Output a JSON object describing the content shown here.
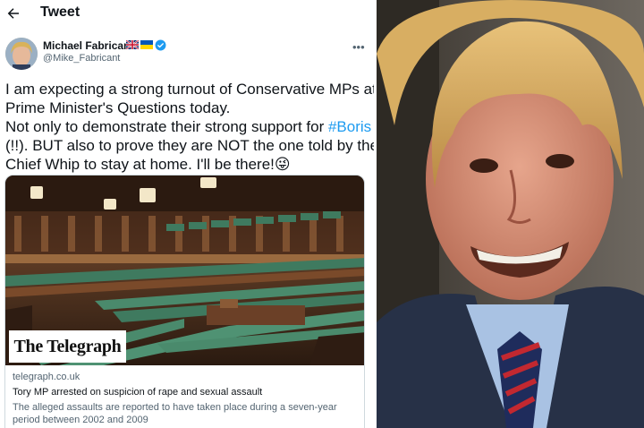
{
  "header": {
    "title": "Tweet"
  },
  "author": {
    "name": "Michael Fabricant",
    "handle": "@Mike_Fabricant",
    "flags": [
      "uk-flag-icon",
      "ukraine-flag-icon",
      "verified-badge-icon"
    ]
  },
  "tweet": {
    "line1": "I am expecting a strong turnout of Conservative MPs at",
    "line2": "Prime Minister's Questions today.",
    "line3_before": "Not only to demonstrate their strong support for ",
    "hashtag": "#Boris",
    "line4": "(!!). BUT also to prove they are NOT the one told by the",
    "line5": "Chief Whip to stay at home.  I'll be there!",
    "emoji": "😜"
  },
  "card": {
    "brand": "The Telegraph",
    "domain": "telegraph.co.uk",
    "title": "Tory MP arrested on suspicion of rape and sexual assault",
    "description": "The alleged assaults are reported to have taken place during a seven-year period between 2002 and 2009"
  },
  "colors": {
    "link": "#1d9bf0",
    "secondary_text": "#536471",
    "bench_green": "#3f7a5f",
    "wood": "#7a4a2a"
  }
}
